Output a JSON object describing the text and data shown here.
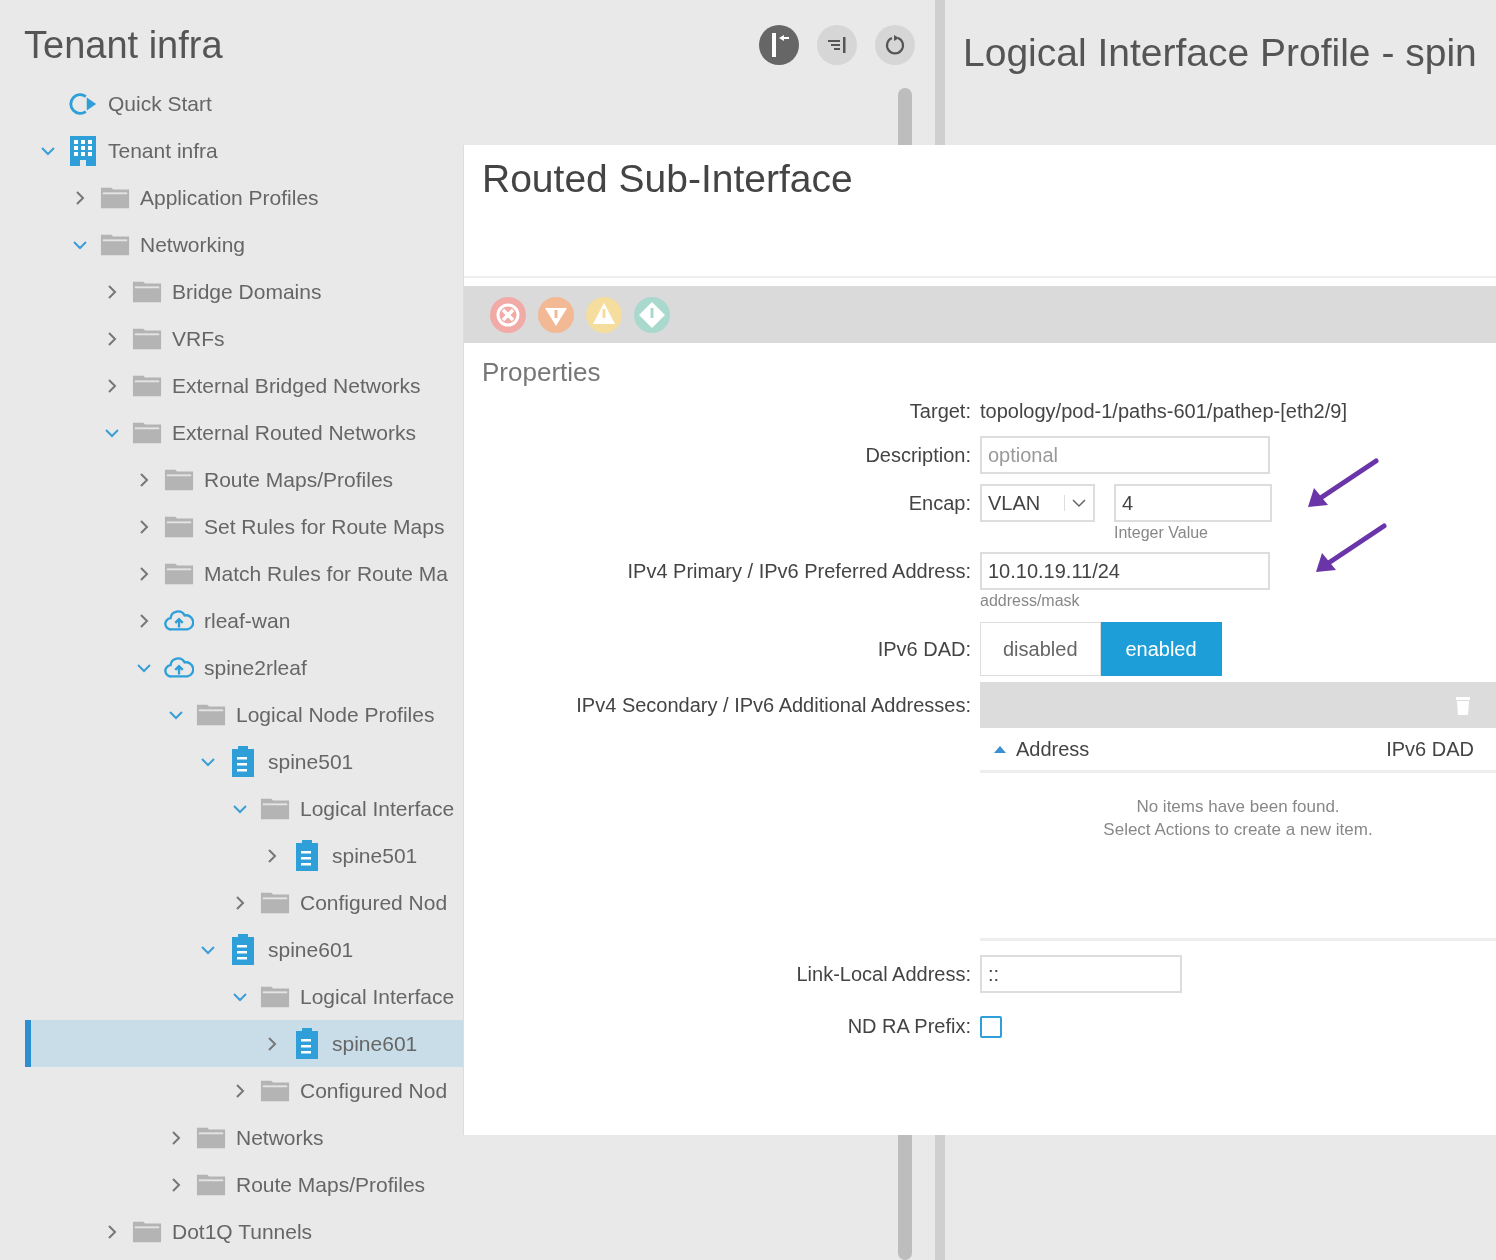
{
  "left_panel": {
    "title": "Tenant infra",
    "tree": [
      {
        "kind": "quickstart",
        "label": "Quick Start",
        "selected": false
      },
      {
        "kind": "tenant",
        "label": "Tenant infra",
        "expanded": true,
        "selected": false,
        "children": [
          {
            "kind": "folder",
            "label": "Application Profiles",
            "expanded": false,
            "selected": false
          },
          {
            "kind": "folder",
            "label": "Networking",
            "expanded": true,
            "selected": false,
            "children": [
              {
                "kind": "folder",
                "label": "Bridge Domains",
                "expanded": false,
                "selected": false
              },
              {
                "kind": "folder",
                "label": "VRFs",
                "expanded": false,
                "selected": false
              },
              {
                "kind": "folder",
                "label": "External Bridged Networks",
                "expanded": false,
                "selected": false
              },
              {
                "kind": "folder",
                "label": "External Routed Networks",
                "expanded": true,
                "selected": false,
                "children": [
                  {
                    "kind": "folder",
                    "label": "Route Maps/Profiles",
                    "expanded": false,
                    "selected": false
                  },
                  {
                    "kind": "folder",
                    "label": "Set Rules for Route Maps",
                    "expanded": false,
                    "selected": false
                  },
                  {
                    "kind": "folder",
                    "label": "Match Rules for Route Ma",
                    "expanded": false,
                    "selected": false
                  },
                  {
                    "kind": "cloud",
                    "label": "rleaf-wan",
                    "expanded": false,
                    "selected": false
                  },
                  {
                    "kind": "cloud",
                    "label": "spine2rleaf",
                    "expanded": true,
                    "selected": false,
                    "children": [
                      {
                        "kind": "folder",
                        "label": "Logical Node Profiles",
                        "expanded": true,
                        "selected": false,
                        "children": [
                          {
                            "kind": "node",
                            "label": "spine501",
                            "expanded": true,
                            "selected": false,
                            "children": [
                              {
                                "kind": "folder",
                                "label": "Logical Interface",
                                "expanded": true,
                                "selected": false,
                                "children": [
                                  {
                                    "kind": "node",
                                    "label": "spine501",
                                    "expanded": false,
                                    "selected": false
                                  }
                                ]
                              },
                              {
                                "kind": "folder",
                                "label": "Configured Nod",
                                "expanded": false,
                                "selected": false
                              }
                            ]
                          },
                          {
                            "kind": "node",
                            "label": "spine601",
                            "expanded": true,
                            "selected": false,
                            "children": [
                              {
                                "kind": "folder",
                                "label": "Logical Interface",
                                "expanded": true,
                                "selected": false,
                                "children": [
                                  {
                                    "kind": "node",
                                    "label": "spine601",
                                    "expanded": false,
                                    "selected": true
                                  }
                                ]
                              },
                              {
                                "kind": "folder",
                                "label": "Configured Nod",
                                "expanded": false,
                                "selected": false
                              }
                            ]
                          }
                        ]
                      },
                      {
                        "kind": "folder",
                        "label": "Networks",
                        "expanded": false,
                        "selected": false
                      },
                      {
                        "kind": "folder",
                        "label": "Route Maps/Profiles",
                        "expanded": false,
                        "selected": false
                      }
                    ]
                  }
                ]
              },
              {
                "kind": "folder",
                "label": "Dot1Q Tunnels",
                "expanded": false,
                "selected": false
              }
            ]
          }
        ]
      }
    ]
  },
  "right_panel": {
    "title": "Logical Interface Profile - spin"
  },
  "dialog": {
    "title": "Routed Sub-Interface",
    "section": "Properties",
    "fields": [
      {
        "kind": "text",
        "label": "Target:",
        "value": "topology/pod-1/paths-601/pathep-[eth2/9]"
      },
      {
        "kind": "input",
        "label": "Description:",
        "placeholder": "optional"
      },
      {
        "kind": "encap",
        "label": "Encap:",
        "select": "VLAN",
        "value": "4",
        "hint": "Integer Value"
      },
      {
        "kind": "input",
        "label": "IPv4 Primary / IPv6 Preferred Address:",
        "value": "10.10.19.11/24",
        "hint": "address/mask"
      },
      {
        "kind": "segmented",
        "label": "IPv6 DAD:",
        "options": [
          {
            "label": "disabled",
            "selected": false
          },
          {
            "label": "enabled",
            "selected": true
          }
        ]
      },
      {
        "kind": "table",
        "label": "IPv4 Secondary / IPv6 Additional Addresses:",
        "columns": [
          {
            "label": "Address",
            "sorted": true
          },
          {
            "label": "IPv6 DAD",
            "sorted": false
          }
        ],
        "empty_message": [
          "No items have been found.",
          "Select Actions to create a new item."
        ]
      },
      {
        "kind": "short_input",
        "label": "Link-Local Address:",
        "value": "::"
      },
      {
        "kind": "checkbox",
        "label": "ND RA Prefix:",
        "checked": false
      }
    ]
  }
}
